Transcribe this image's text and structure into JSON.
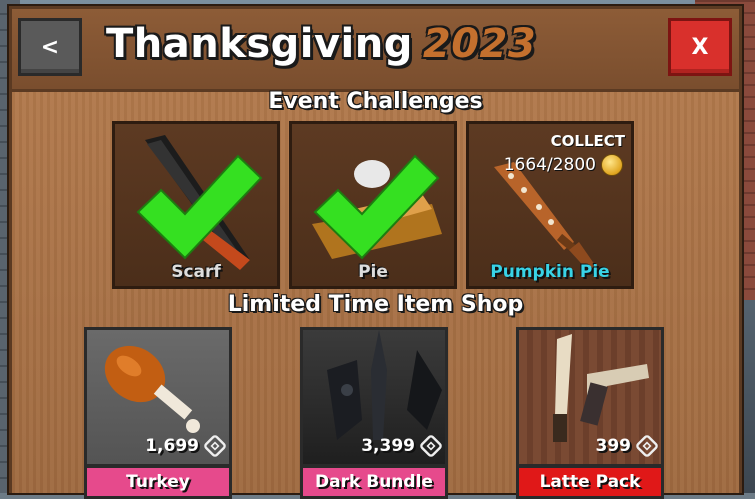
{
  "header": {
    "back_label": "<",
    "title": "Thanksgiving",
    "year": "2023",
    "close_label": "X"
  },
  "challenges": {
    "heading": "Event Challenges",
    "items": [
      {
        "name": "Scarf",
        "completed": true
      },
      {
        "name": "Pie",
        "completed": true
      },
      {
        "name": "Pumpkin Pie",
        "completed": false,
        "collect_label": "COLLECT",
        "progress": "1664/2800",
        "progress_value": 1664,
        "progress_goal": 2800
      }
    ],
    "colors": {
      "check": "#35e021",
      "reward_name": "#39d3e6"
    }
  },
  "shop": {
    "heading": "Limited Time Item Shop",
    "items": [
      {
        "name": "Turkey",
        "price": "1,699",
        "currency_icon": "robux-icon",
        "label_color": "#e64a8c"
      },
      {
        "name": "Dark Bundle",
        "price": "3,399",
        "currency_icon": "robux-icon",
        "label_color": "#e64a8c"
      },
      {
        "name": "Latte Pack",
        "price": "399",
        "currency_icon": "robux-icon",
        "label_color": "#e01818"
      }
    ]
  }
}
